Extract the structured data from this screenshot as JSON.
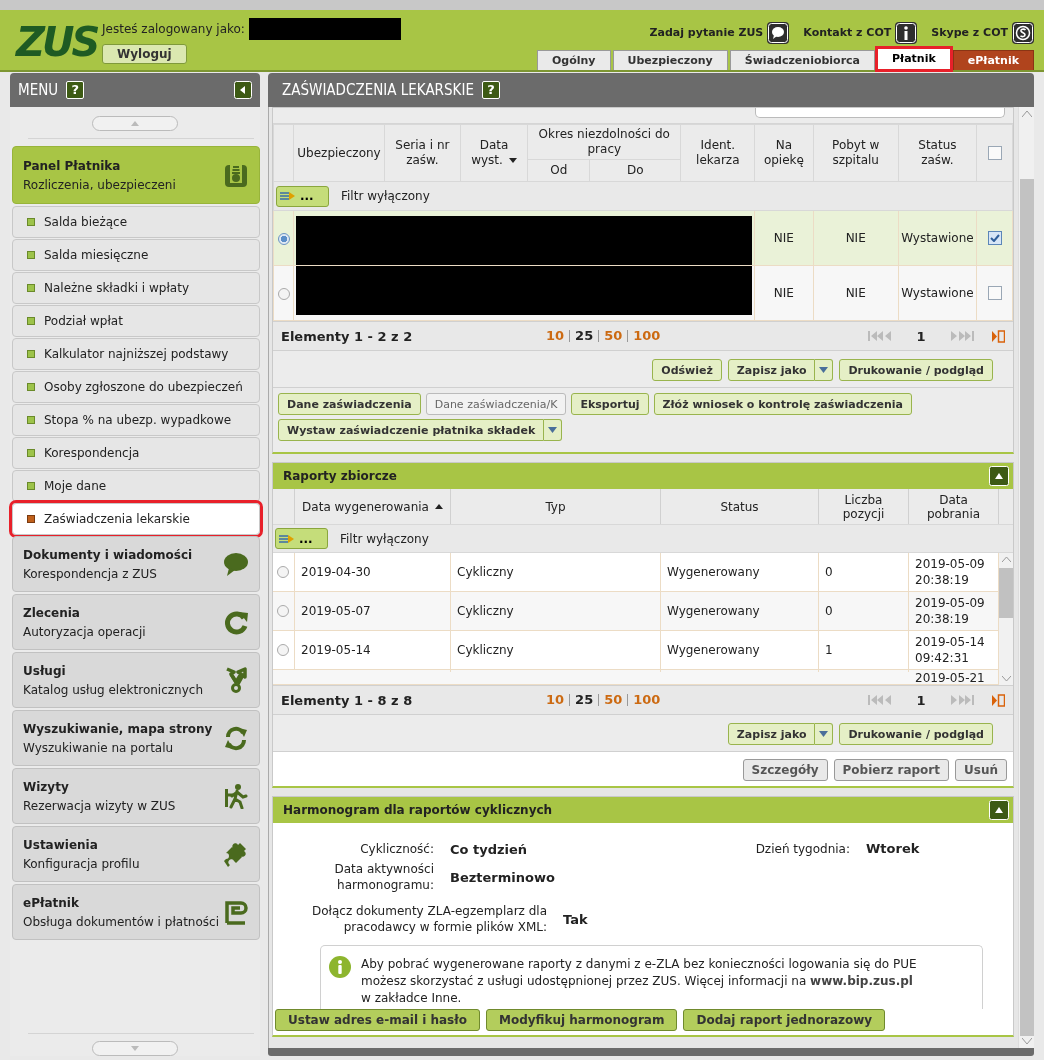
{
  "header": {
    "logo": "ZUS",
    "logged_as_label": "Jesteś zalogowany jako:",
    "user_redacted": true,
    "logout_button": "Wyloguj",
    "links": [
      {
        "label": "Zadaj pytanie ZUS"
      },
      {
        "label": "Kontakt z COT"
      },
      {
        "label": "Skype z COT"
      }
    ]
  },
  "tabs": [
    {
      "label": "Ogólny",
      "selected": false,
      "highlighted": false,
      "kind": "plain"
    },
    {
      "label": "Ubezpieczony",
      "selected": false,
      "highlighted": false,
      "kind": "plain"
    },
    {
      "label": "Świadczeniobiorca",
      "selected": false,
      "highlighted": false,
      "kind": "plain"
    },
    {
      "label": "Płatnik",
      "selected": true,
      "highlighted": true,
      "kind": "plain"
    },
    {
      "label": "ePłatnik",
      "selected": false,
      "highlighted": false,
      "kind": "accent"
    }
  ],
  "menu": {
    "title": "MENU",
    "help": "?",
    "groups": [
      {
        "title": "Panel Płatnika",
        "subtitle": "Rozliczenia, ubezpieczeni",
        "expanded": true,
        "items": [
          {
            "label": "Salda bieżące",
            "selected": false,
            "highlighted": false
          },
          {
            "label": "Salda miesięczne",
            "selected": false,
            "highlighted": false
          },
          {
            "label": "Należne składki i wpłaty",
            "selected": false,
            "highlighted": false
          },
          {
            "label": "Podział wpłat",
            "selected": false,
            "highlighted": false
          },
          {
            "label": "Kalkulator najniższej podstawy",
            "selected": false,
            "highlighted": false
          },
          {
            "label": "Osoby zgłoszone do ubezpieczeń",
            "selected": false,
            "highlighted": false
          },
          {
            "label": "Stopa % na ubezp. wypadkowe",
            "selected": false,
            "highlighted": false
          },
          {
            "label": "Korespondencja",
            "selected": false,
            "highlighted": false
          },
          {
            "label": "Moje dane",
            "selected": false,
            "highlighted": false
          },
          {
            "label": "Zaświadczenia lekarskie",
            "selected": true,
            "highlighted": true
          }
        ]
      },
      {
        "title": "Dokumenty i wiadomości",
        "subtitle": "Korespondencja z ZUS",
        "expanded": false
      },
      {
        "title": "Zlecenia",
        "subtitle": "Autoryzacja operacji",
        "expanded": false
      },
      {
        "title": "Usługi",
        "subtitle": "Katalog usług elektronicznych",
        "expanded": false
      },
      {
        "title": "Wyszukiwanie, mapa strony",
        "subtitle": "Wyszukiwanie na portalu",
        "expanded": false
      },
      {
        "title": "Wizyty",
        "subtitle": "Rezerwacja wizyty w ZUS",
        "expanded": false
      },
      {
        "title": "Ustawienia",
        "subtitle": "Konfiguracja profilu",
        "expanded": false
      },
      {
        "title": "ePłatnik",
        "subtitle": "Obsługa dokumentów i płatności",
        "expanded": false
      }
    ]
  },
  "page": {
    "title": "ZAŚWIADCZENIA LEKARSKIE",
    "help": "?"
  },
  "certificates": {
    "columns": [
      {
        "label": "Ubezpieczony"
      },
      {
        "label": "Seria i nr zaśw."
      },
      {
        "label": "Data wyst.",
        "sort_ascending": false
      },
      {
        "label": "Okres niezdolności do pracy",
        "children": [
          {
            "label": "Od"
          },
          {
            "label": "Do"
          }
        ]
      },
      {
        "label": "Ident. lekarza"
      },
      {
        "label": "Na opiekę"
      },
      {
        "label": "Pobyt w szpitalu"
      },
      {
        "label": "Status zaśw."
      }
    ],
    "select_all_checked": false,
    "filter_button": "...",
    "filter_label": "Filtr wyłączony",
    "rows": [
      {
        "selected": true,
        "checked": true,
        "redacted": true,
        "na_opieke": "NIE",
        "pobyt_w_szpitalu": "NIE",
        "status": "Wystawione"
      },
      {
        "selected": false,
        "checked": false,
        "redacted": true,
        "na_opieke": "NIE",
        "pobyt_w_szpitalu": "NIE",
        "status": "Wystawione"
      }
    ],
    "pager": {
      "summary": "Elementy 1 - 2 z 2",
      "page_sizes": [
        {
          "label": "10",
          "selected": false
        },
        {
          "label": "25",
          "selected": true
        },
        {
          "label": "50",
          "selected": false
        },
        {
          "label": "100",
          "selected": false
        }
      ],
      "page": "1"
    },
    "toolbar": [
      {
        "label": "Odśwież",
        "kind": "plain"
      },
      {
        "label": "Zapisz jako",
        "kind": "dropdown"
      },
      {
        "label": "Drukowanie / podgląd",
        "kind": "plain"
      }
    ],
    "actions": [
      {
        "label": "Dane zaświadczenia",
        "disabled": false,
        "kind": "plain"
      },
      {
        "label": "Dane zaświadczenia/K",
        "disabled": true,
        "kind": "plain"
      },
      {
        "label": "Eksportuj",
        "disabled": false,
        "kind": "plain"
      },
      {
        "label": "Złóż wniosek o kontrolę zaświadczenia",
        "disabled": false,
        "kind": "plain"
      },
      {
        "label": "Wystaw zaświadczenie płatnika składek",
        "disabled": false,
        "kind": "dropdown"
      }
    ]
  },
  "reports": {
    "title": "Raporty zbiorcze",
    "expanded": true,
    "columns": [
      {
        "label": "Data wygenerowania",
        "sort_ascending": true
      },
      {
        "label": "Typ"
      },
      {
        "label": "Status"
      },
      {
        "label": "Liczba pozycji"
      },
      {
        "label": "Data pobrania"
      }
    ],
    "filter_button": "...",
    "filter_label": "Filtr wyłączony",
    "rows": [
      {
        "selected": false,
        "data_wygenerowania": "2019-04-30",
        "typ": "Cykliczny",
        "status": "Wygenerowany",
        "liczba_pozycji": "0",
        "data_pobrania": "2019-05-09 20:38:19"
      },
      {
        "selected": false,
        "data_wygenerowania": "2019-05-07",
        "typ": "Cykliczny",
        "status": "Wygenerowany",
        "liczba_pozycji": "0",
        "data_pobrania": "2019-05-09 20:38:19"
      },
      {
        "selected": false,
        "data_wygenerowania": "2019-05-14",
        "typ": "Cykliczny",
        "status": "Wygenerowany",
        "liczba_pozycji": "1",
        "data_pobrania": "2019-05-14 09:42:31"
      },
      {
        "data_pobrania": "2019-05-21"
      }
    ],
    "pager": {
      "summary": "Elementy 1 - 8 z 8",
      "page_sizes": [
        {
          "label": "10",
          "selected": false
        },
        {
          "label": "25",
          "selected": true
        },
        {
          "label": "50",
          "selected": false
        },
        {
          "label": "100",
          "selected": false
        }
      ],
      "page": "1"
    },
    "toolbar": [
      {
        "label": "Zapisz jako",
        "kind": "dropdown"
      },
      {
        "label": "Drukowanie / podgląd",
        "kind": "plain"
      }
    ],
    "actions": [
      {
        "label": "Szczegóły",
        "kind": "grey"
      },
      {
        "label": "Pobierz raport",
        "kind": "grey"
      },
      {
        "label": "Usuń",
        "kind": "grey"
      }
    ]
  },
  "schedule": {
    "title": "Harmonogram dla raportów cyklicznych",
    "expanded": true,
    "fields": [
      {
        "label": "Cykliczność:",
        "value": "Co tydzień"
      },
      {
        "label": "Data aktywności harmonogramu:",
        "value": "Bezterminowo"
      },
      {
        "label": "Dołącz dokumenty ZLA-egzemplarz dla pracodawcy w formie plików XML:",
        "value": "Tak"
      }
    ],
    "side_field": {
      "label": "Dzień tygodnia:",
      "value": "Wtorek"
    },
    "info": "Aby pobrać wygenerowane raporty z danymi z e-ZLA bez konieczności logowania się do PUE możesz skorzystać z usługi udostępnionej przez ZUS. Więcej informacji na **www.bip.zus.pl** w zakładce Inne.",
    "buttons": [
      {
        "label": "Ustaw adres e-mail i hasło"
      },
      {
        "label": "Modyfikuj harmonogram"
      },
      {
        "label": "Dodaj raport jednorazowy"
      }
    ]
  }
}
